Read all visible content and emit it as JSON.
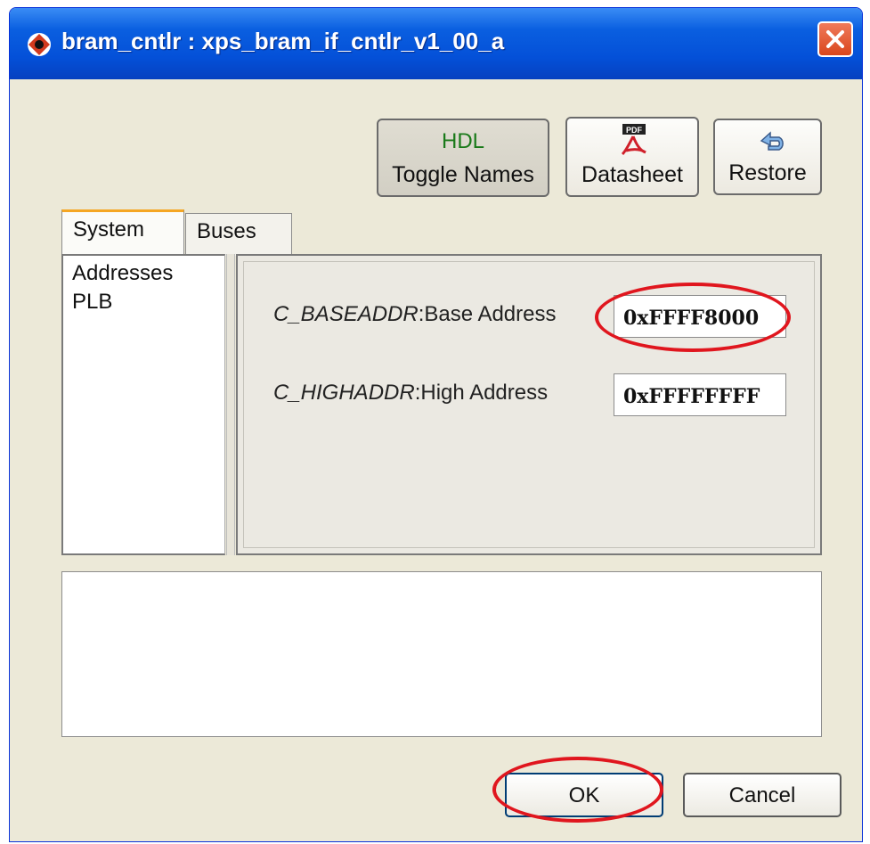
{
  "window": {
    "title": "bram_cntlr : xps_bram_if_cntlr_v1_00_a"
  },
  "toolbar": {
    "toggle_names": {
      "icon_text": "HDL",
      "label": "Toggle Names"
    },
    "datasheet": {
      "icon": "pdf-icon",
      "icon_text": "PDF",
      "label": "Datasheet"
    },
    "restore": {
      "icon": "restore-icon",
      "label": "Restore"
    }
  },
  "tabs": [
    {
      "label": "System",
      "active": true
    },
    {
      "label": "Buses",
      "active": false
    }
  ],
  "nav": {
    "items": [
      "Addresses",
      "PLB"
    ]
  },
  "params": [
    {
      "name": "C_BASEADDR",
      "desc": "Base Address",
      "value": "0xFFFF8000"
    },
    {
      "name": "C_HIGHADDR",
      "desc": "High Address",
      "value": "0xFFFFFFFF"
    }
  ],
  "buttons": {
    "ok": "OK",
    "cancel": "Cancel"
  },
  "colors": {
    "titlebar": "#0450d8",
    "window_bg": "#ece9d8",
    "highlight": "#e0161e"
  }
}
